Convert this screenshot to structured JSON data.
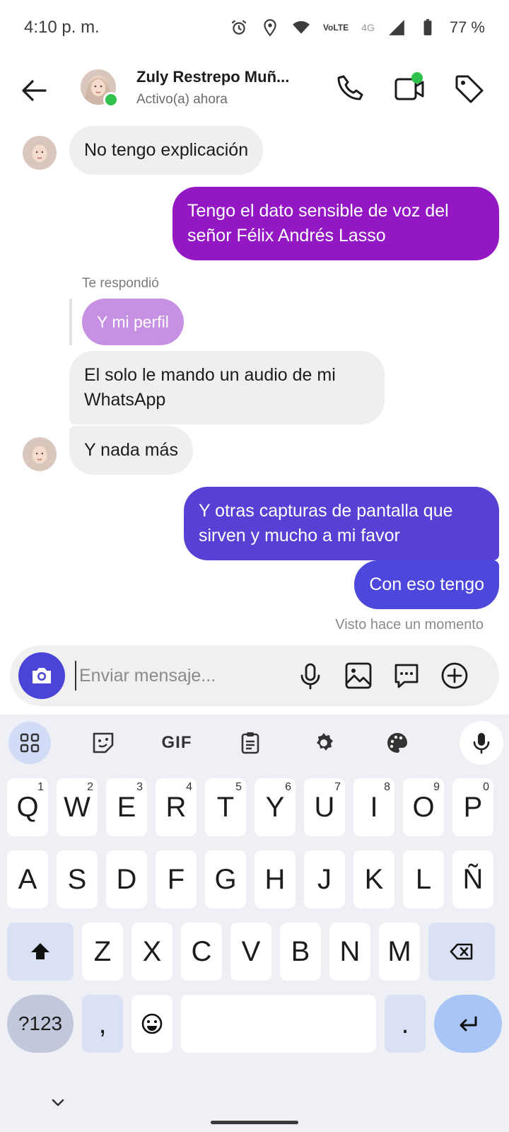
{
  "status_bar": {
    "time": "4:10 p. m.",
    "network": "4G",
    "volte": "VoLTE",
    "battery": "77 %"
  },
  "header": {
    "contact_name": "Zuly Restrepo Muñ...",
    "contact_status": "Activo(a) ahora"
  },
  "messages": {
    "m1": "No tengo explicación",
    "m2": "Tengo el dato sensible de voz del señor Félix Andrés Lasso",
    "reply_label": "Te respondió",
    "reply_quote": "Y mi perfil",
    "m3": "El solo le mando un audio de mi WhatsApp",
    "m4": "Y nada más",
    "m5": "Y otras capturas de pantalla que sirven y mucho a mi favor",
    "m6": "Con eso tengo",
    "seen": "Visto hace un momento"
  },
  "composer": {
    "placeholder": "Enviar mensaje..."
  },
  "keyboard": {
    "toolbar": {
      "gif": "GIF"
    },
    "row1": [
      "Q",
      "W",
      "E",
      "R",
      "T",
      "Y",
      "U",
      "I",
      "O",
      "P"
    ],
    "row1_hints": [
      "1",
      "2",
      "3",
      "4",
      "5",
      "6",
      "7",
      "8",
      "9",
      "0"
    ],
    "row2": [
      "A",
      "S",
      "D",
      "F",
      "G",
      "H",
      "J",
      "K",
      "L",
      "Ñ"
    ],
    "row3": [
      "Z",
      "X",
      "C",
      "V",
      "B",
      "N",
      "M"
    ],
    "symbols": "?123",
    "comma": ",",
    "period": "."
  },
  "colors": {
    "accent": "#4a45d6",
    "bubble_out_top": "#9d18c6",
    "bubble_out_bottom": "#4e47db",
    "online": "#31c24d"
  }
}
